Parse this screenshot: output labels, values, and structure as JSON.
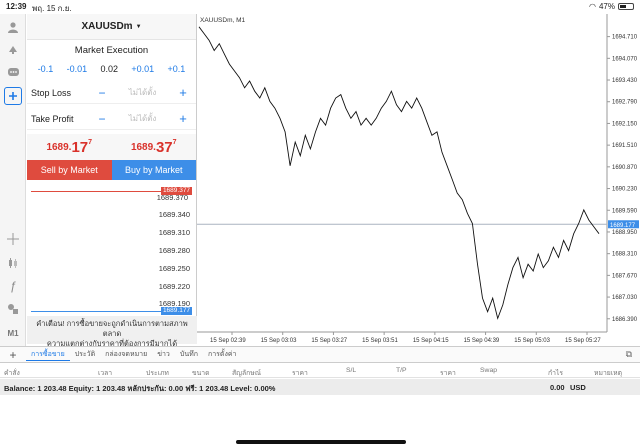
{
  "status_bar": {
    "time": "12:39",
    "date": "พฤ. 15 ก.ย.",
    "battery": "47%"
  },
  "left_tools": [
    "user-icon",
    "trade-icon",
    "chat-icon",
    "add-order-icon",
    "crosshair-icon",
    "candle-icon",
    "function-icon",
    "objects-icon",
    "timeframe-icon"
  ],
  "left_tools_timeframe": "M1",
  "panel": {
    "symbol": "XAUUSDm",
    "caret": "▼",
    "execution": "Market Execution",
    "volume_steps": [
      "-0.1",
      "-0.01",
      "0.02",
      "+0.01",
      "+0.1"
    ],
    "stop_loss": {
      "label": "Stop Loss",
      "value": "ไม่ได้ตั้ง",
      "minus": "−",
      "plus": "+"
    },
    "take_profit": {
      "label": "Take Profit",
      "value": "ไม่ได้ตั้ง",
      "minus": "−",
      "plus": "+"
    },
    "bid": {
      "prefix": "1689.",
      "big": "17",
      "sup": "7"
    },
    "ask": {
      "prefix": "1689.",
      "big": "37",
      "sup": "7"
    },
    "sell_label": "Sell by Market",
    "buy_label": "Buy by Market",
    "depth_levels": [
      "1689.370",
      "1689.340",
      "1689.310",
      "1689.280",
      "1689.250",
      "1689.220",
      "1689.190"
    ],
    "ask_tag": "1689.377",
    "bid_tag": "1689.177",
    "warning_line1": "คำเตือน! การซื้อขายจะถูกดำเนินการตามสภาพตลาด",
    "warning_line2": "ความแตกต่างกับราคาที่ต้องการมีมากได้"
  },
  "chart_data": {
    "type": "line",
    "title": "XAUUSDm, M1",
    "ylim": [
      1686.0,
      1695.2
    ],
    "yticks": [
      "1694.710",
      "1694.070",
      "1693.430",
      "1692.790",
      "1692.150",
      "1691.510",
      "1690.870",
      "1690.230",
      "1689.590",
      "1688.950",
      "1688.310",
      "1687.670",
      "1687.030",
      "1686.390"
    ],
    "ytick_values": [
      1694.71,
      1694.07,
      1693.43,
      1692.79,
      1692.15,
      1691.51,
      1690.87,
      1690.23,
      1689.59,
      1688.95,
      1688.31,
      1687.67,
      1687.03,
      1686.39
    ],
    "xticks": [
      "15 Sep 02:39",
      "15 Sep 03:03",
      "15 Sep 03:27",
      "15 Sep 03:51",
      "15 Sep 04:15",
      "15 Sep 04:39",
      "15 Sep 05:03",
      "15 Sep 05:27"
    ],
    "current_price": 1689.177,
    "current_price_label": "1689.177",
    "series": [
      {
        "values": [
          1695.0,
          1694.8,
          1694.6,
          1694.3,
          1694.5,
          1694.2,
          1693.9,
          1693.7,
          1693.5,
          1693.2,
          1693.4,
          1693.1,
          1692.9,
          1693.2,
          1692.8,
          1692.6,
          1692.3,
          1691.9,
          1690.9,
          1691.6,
          1691.2,
          1691.8,
          1691.4,
          1691.9,
          1692.3,
          1692.1,
          1692.6,
          1692.9,
          1693.0,
          1692.6,
          1692.3,
          1692.5,
          1692.1,
          1692.3,
          1692.1,
          1692.3,
          1692.6,
          1692.8,
          1693.1,
          1692.7,
          1692.5,
          1692.8,
          1692.6,
          1692.9,
          1692.6,
          1692.2,
          1691.8,
          1691.9,
          1691.3,
          1690.9,
          1690.5,
          1690.1,
          1689.9,
          1689.5,
          1689.2,
          1688.0,
          1687.0,
          1686.6,
          1687.0,
          1686.4,
          1686.8,
          1687.4,
          1687.9,
          1688.2,
          1687.6,
          1688.0,
          1687.8,
          1688.3,
          1687.9,
          1688.1,
          1688.5,
          1688.2,
          1688.7,
          1688.4,
          1688.9,
          1689.2,
          1689.6,
          1689.3,
          1689.1,
          1688.9
        ]
      }
    ]
  },
  "tabs": {
    "plus": "+",
    "items": [
      "การซื้อขาย",
      "ประวัติ",
      "กล่องจดหมาย",
      "ข่าว",
      "บันทึก",
      "การตั้งค่า"
    ],
    "active": 0
  },
  "table_headers": [
    "คำสั่ง",
    "เวลา",
    "ประเภท",
    "ขนาด",
    "สัญลักษณ์",
    "ราคา",
    "S/L",
    "T/P",
    "ราคา",
    "Swap",
    "กำไร",
    "หมายเหตุ"
  ],
  "balance": {
    "text": "Balance: 1 203.48  Equity: 1 203.48  หลักประกัน: 0.00  ฟรี: 1 203.48  Level: 0.00%",
    "amount": "0.00",
    "currency": "USD"
  }
}
